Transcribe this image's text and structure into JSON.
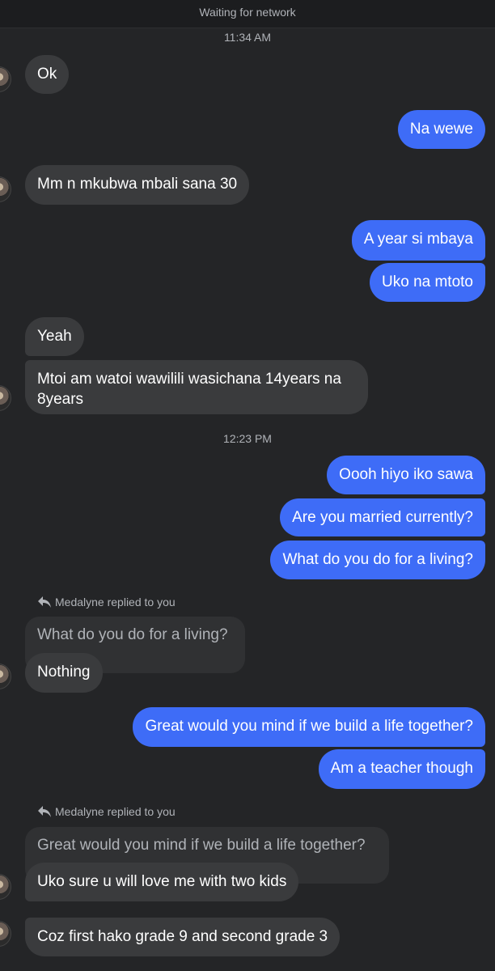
{
  "status": {
    "network": "Waiting for network"
  },
  "timestamps": [
    "11:34 AM",
    "12:23 PM"
  ],
  "reply_notices": [
    "Medalyne replied to you",
    "Medalyne replied to you"
  ],
  "quotes": [
    "What do you do for a living?",
    "Great would you mind if we build a life together?"
  ],
  "messages": [
    {
      "from": "them",
      "text": "Ok"
    },
    {
      "from": "me",
      "text": "Na wewe"
    },
    {
      "from": "them",
      "text": "Mm n mkubwa mbali sana 30"
    },
    {
      "from": "me",
      "text": "A year si mbaya"
    },
    {
      "from": "me",
      "text": "Uko na mtoto"
    },
    {
      "from": "them",
      "text": "Yeah"
    },
    {
      "from": "them",
      "text": "Mtoi am watoi wawilili wasichana 14years na"
    },
    {
      "from": "them",
      "text": "8years"
    },
    {
      "from": "me",
      "text": "Oooh hiyo iko sawa"
    },
    {
      "from": "me",
      "text": "Are you married currently?"
    },
    {
      "from": "me",
      "text": "What do you do for a living?"
    },
    {
      "from": "them",
      "text": "Nothing"
    },
    {
      "from": "me",
      "text": "Great would you mind if we build a life together?"
    },
    {
      "from": "me",
      "text": "Am a teacher though"
    },
    {
      "from": "them",
      "text": "Uko sure u will love me with two kids"
    },
    {
      "from": "them",
      "text": "Coz first hako grade 9 and second grade 3"
    }
  ],
  "colors": {
    "background": "#242527",
    "incoming": "#3a3b3d",
    "outgoing": "#3e6cf7",
    "quote": "#303133"
  }
}
